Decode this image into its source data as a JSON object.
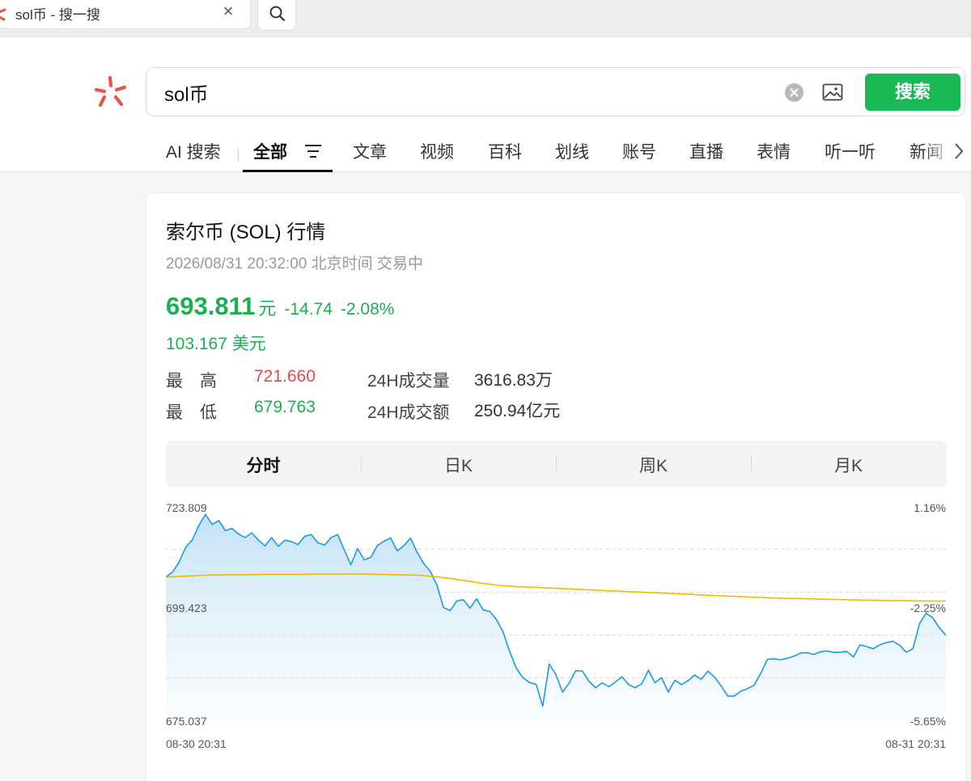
{
  "browser": {
    "tab_title": "sol币 - 搜一搜",
    "close_glyph": "×"
  },
  "search": {
    "query": "sol币",
    "button_label": "搜索"
  },
  "nav": {
    "items": [
      "AI 搜索",
      "全部",
      "文章",
      "视频",
      "百科",
      "划线",
      "账号",
      "直播",
      "表情",
      "听一听",
      "新闻"
    ],
    "active": "全部"
  },
  "quote": {
    "title": "索尔币 (SOL) 行情",
    "timestamp": "2026/08/31 20:32:00 北京时间 交易中",
    "price": "693.811",
    "price_unit": "元",
    "change": "-14.74",
    "change_pct": "-2.08%",
    "usd_price": "103.167 美元",
    "high_label": "最　高",
    "high_value": "721.660",
    "low_label": "最　低",
    "low_value": "679.763",
    "volume_label": "24H成交量",
    "volume_value": "3616.83万",
    "turnover_label": "24H成交额",
    "turnover_value": "250.94亿元"
  },
  "kline_tabs": [
    "分时",
    "日K",
    "周K",
    "月K"
  ],
  "colors": {
    "accent_green": "#19b955",
    "down_green": "#1fad53",
    "up_red": "#e24a4a",
    "price_line": "#1a9be0",
    "avg_line": "#f2b705"
  },
  "chart_data": {
    "type": "line",
    "title": "",
    "xlabel": "",
    "ylabel": "",
    "x_labels": [
      "08-30 20:31",
      "08-31 20:31"
    ],
    "y_ticks": [
      "723.809",
      "699.423",
      "675.037"
    ],
    "y_pct_ticks": [
      "1.16%",
      "-2.25%",
      "-5.65%"
    ],
    "ylim": [
      675.037,
      723.809
    ],
    "grid": true,
    "series": [
      {
        "type": "area",
        "values": [
          707.8,
          708.9,
          711.2,
          714.6,
          716.3,
          719.6,
          722.1,
          719.8,
          720.7,
          718.4,
          718.9,
          717.6,
          716.8,
          717.9,
          716.2,
          714.9,
          716.8,
          714.8,
          716.2,
          715.9,
          715.2,
          717.1,
          717.5,
          715.6,
          715.1,
          716.8,
          717.5,
          713.9,
          710.6,
          714.3,
          711.7,
          712.3,
          715.0,
          716.0,
          716.7,
          713.8,
          714.9,
          716.7,
          713.5,
          710.9,
          709.1,
          706.0,
          700.8,
          700.1,
          702.3,
          702.6,
          700.7,
          702.8,
          700.3,
          699.9,
          698.1,
          695.3,
          690.8,
          687.0,
          684.8,
          683.7,
          683.3,
          678.3,
          687.9,
          685.5,
          681.5,
          683.5,
          686.4,
          686.3,
          684.0,
          682.5,
          683.6,
          682.7,
          683.8,
          685.0,
          683.2,
          682.5,
          683.4,
          686.5,
          683.6,
          684.8,
          681.5,
          684.2,
          683.2,
          684.1,
          685.4,
          684.4,
          686.3,
          684.9,
          682.9,
          680.6,
          680.6,
          681.7,
          682.3,
          683.1,
          685.8,
          689.0,
          689.1,
          688.9,
          689.2,
          689.7,
          690.4,
          690.5,
          690.1,
          690.7,
          690.9,
          690.6,
          690.6,
          690.8,
          689.5,
          692.3,
          691.9,
          691.4,
          692.3,
          692.8,
          693.1,
          692.2,
          690.6,
          691.4,
          697.1,
          699.5,
          698.5,
          696.2,
          694.5
        ]
      },
      {
        "type": "line",
        "values": [
          707.8,
          708.0,
          708.2,
          708.3,
          708.3,
          708.4,
          708.4,
          708.4,
          708.5,
          708.5,
          708.5,
          708.4,
          708.3,
          708.2,
          707.8,
          707.2,
          706.5,
          705.9,
          705.6,
          705.4,
          705.2,
          705.0,
          704.8,
          704.6,
          704.4,
          704.2,
          704.0,
          703.8,
          703.6,
          703.4,
          703.2,
          703.0,
          702.9,
          702.8,
          702.7,
          702.6,
          702.5,
          702.4,
          702.4,
          702.3,
          702.3
        ]
      }
    ]
  }
}
